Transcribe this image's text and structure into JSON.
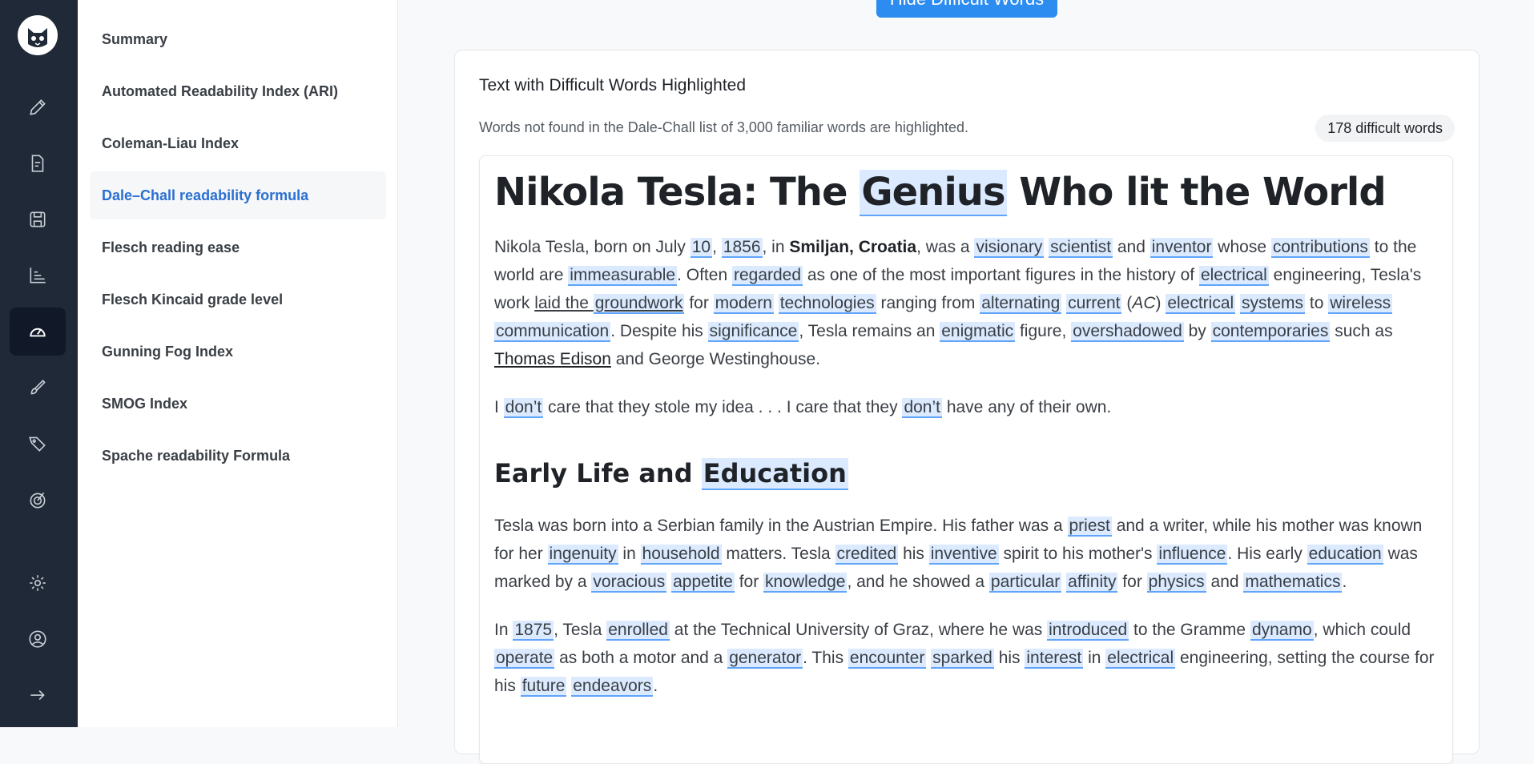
{
  "sidebar": {
    "items": [
      {
        "label": "Summary"
      },
      {
        "label": "Automated Readability Index (ARI)"
      },
      {
        "label": "Coleman-Liau Index"
      },
      {
        "label": "Dale–Chall readability formula"
      },
      {
        "label": "Flesch reading ease"
      },
      {
        "label": "Flesch Kincaid grade level"
      },
      {
        "label": "Gunning Fog Index"
      },
      {
        "label": "SMOG Index"
      },
      {
        "label": "Spache readability Formula"
      }
    ]
  },
  "toolbar": {
    "hide_label": "Hide Difficult Words"
  },
  "card": {
    "title": "Text with Difficult Words Highlighted",
    "subtitle": "Words not found in the Dale-Chall list of 3,000 familiar words are highlighted.",
    "badge": "178 difficult words"
  },
  "doc": {
    "title_parts": [
      "Nikola Tesla: The ",
      "Genius",
      " Who lit the World"
    ],
    "heading2_parts": [
      "Early Life and ",
      "Education"
    ]
  },
  "colors": {
    "rail": "#1f2937",
    "accent": "#2a6fd1",
    "highlight": "#dbeafe",
    "button": "#2d8cf0"
  },
  "icons": [
    "logo-cat-icon",
    "pencil-icon",
    "document-edit-icon",
    "save-icon",
    "chart-icon",
    "gauge-icon",
    "brush-icon",
    "tags-icon",
    "target-icon",
    "gear-icon",
    "user-circle-icon",
    "arrow-right-icon"
  ]
}
